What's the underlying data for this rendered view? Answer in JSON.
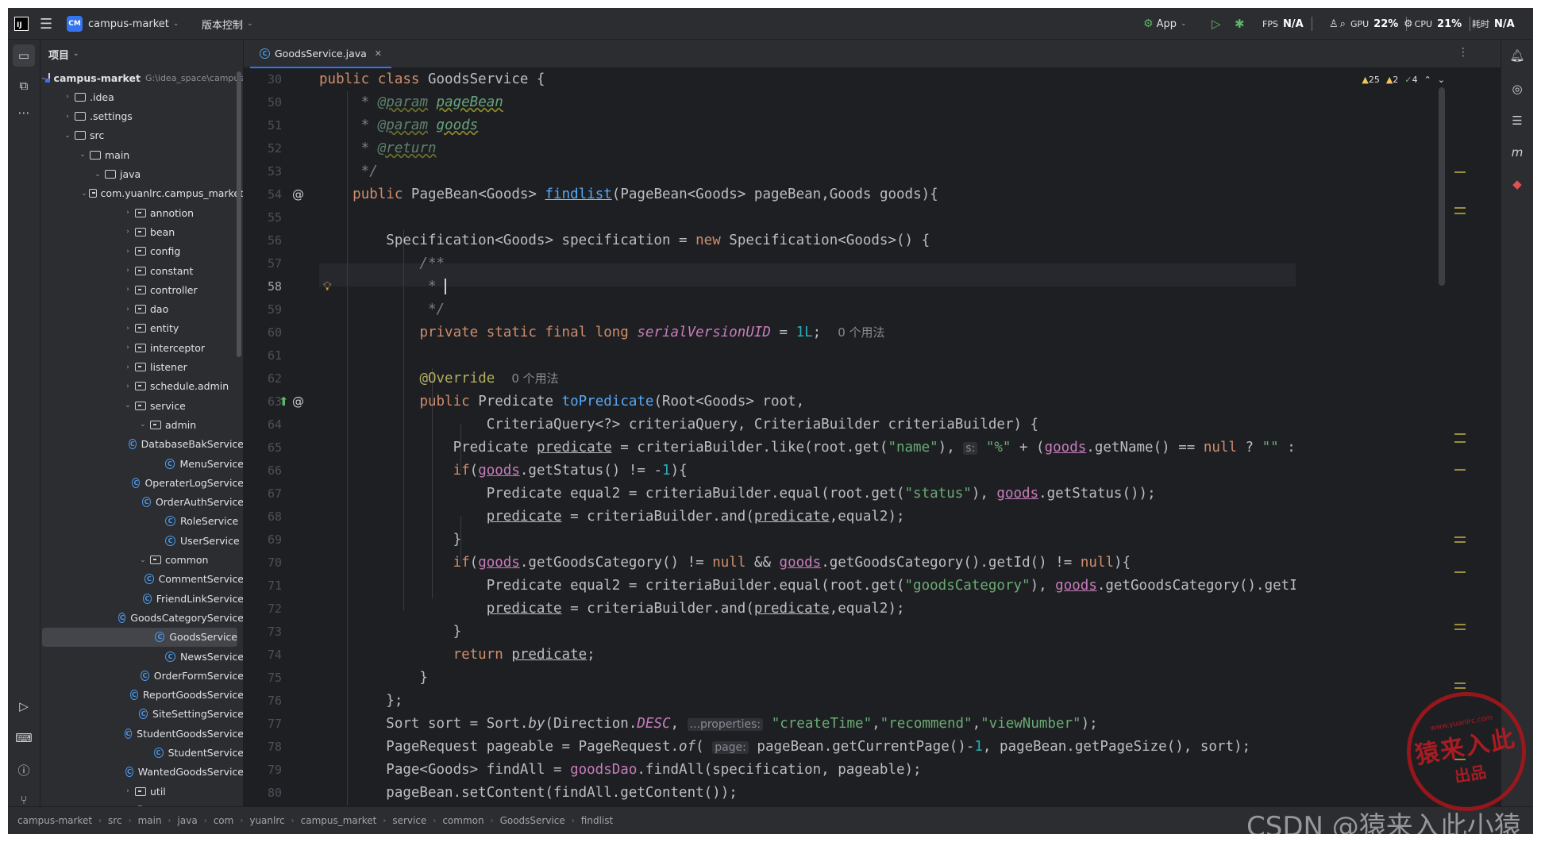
{
  "titlebar": {
    "project_badge": "CM",
    "project_name": "campus-market",
    "vcs_label": "版本控制",
    "run_config": "App",
    "fps_label": "FPS",
    "fps_value": "N/A",
    "gpu_label": "GPU",
    "gpu_value": "22%",
    "cpu_label": "CPU",
    "cpu_value": "21%",
    "time_label": "耗时",
    "time_value": "N/A"
  },
  "project_panel": {
    "header": "项目",
    "rows": [
      {
        "depth": 0,
        "arrow": "⌄",
        "icon": "module",
        "label": "campus-market",
        "path": "G:\\idea_space\\campus-market",
        "bold": true
      },
      {
        "depth": 1,
        "arrow": "›",
        "icon": "folder",
        "label": ".idea"
      },
      {
        "depth": 1,
        "arrow": "›",
        "icon": "folder",
        "label": ".settings"
      },
      {
        "depth": 1,
        "arrow": "⌄",
        "icon": "folder",
        "label": "src"
      },
      {
        "depth": 2,
        "arrow": "⌄",
        "icon": "folder",
        "label": "main"
      },
      {
        "depth": 3,
        "arrow": "⌄",
        "icon": "folder",
        "label": "java"
      },
      {
        "depth": 4,
        "arrow": "⌄",
        "icon": "package",
        "label": "com.yuanlrc.campus_market"
      },
      {
        "depth": 5,
        "arrow": "›",
        "icon": "package",
        "label": "annotion"
      },
      {
        "depth": 5,
        "arrow": "›",
        "icon": "package",
        "label": "bean"
      },
      {
        "depth": 5,
        "arrow": "›",
        "icon": "package",
        "label": "config"
      },
      {
        "depth": 5,
        "arrow": "›",
        "icon": "package",
        "label": "constant"
      },
      {
        "depth": 5,
        "arrow": "›",
        "icon": "package",
        "label": "controller"
      },
      {
        "depth": 5,
        "arrow": "›",
        "icon": "package",
        "label": "dao"
      },
      {
        "depth": 5,
        "arrow": "›",
        "icon": "package",
        "label": "entity"
      },
      {
        "depth": 5,
        "arrow": "›",
        "icon": "package",
        "label": "interceptor"
      },
      {
        "depth": 5,
        "arrow": "›",
        "icon": "package",
        "label": "listener"
      },
      {
        "depth": 5,
        "arrow": "›",
        "icon": "package",
        "label": "schedule.admin"
      },
      {
        "depth": 5,
        "arrow": "⌄",
        "icon": "package",
        "label": "service"
      },
      {
        "depth": 6,
        "arrow": "⌄",
        "icon": "package",
        "label": "admin"
      },
      {
        "depth": 7,
        "arrow": "",
        "icon": "class",
        "label": "DatabaseBakService"
      },
      {
        "depth": 7,
        "arrow": "",
        "icon": "class",
        "label": "MenuService"
      },
      {
        "depth": 7,
        "arrow": "",
        "icon": "class",
        "label": "OperaterLogService"
      },
      {
        "depth": 7,
        "arrow": "",
        "icon": "class",
        "label": "OrderAuthService"
      },
      {
        "depth": 7,
        "arrow": "",
        "icon": "class",
        "label": "RoleService"
      },
      {
        "depth": 7,
        "arrow": "",
        "icon": "class",
        "label": "UserService"
      },
      {
        "depth": 6,
        "arrow": "⌄",
        "icon": "package",
        "label": "common"
      },
      {
        "depth": 7,
        "arrow": "",
        "icon": "class",
        "label": "CommentService"
      },
      {
        "depth": 7,
        "arrow": "",
        "icon": "class",
        "label": "FriendLinkService"
      },
      {
        "depth": 7,
        "arrow": "",
        "icon": "class",
        "label": "GoodsCategoryService"
      },
      {
        "depth": 7,
        "arrow": "",
        "icon": "class",
        "label": "GoodsService",
        "selected": true
      },
      {
        "depth": 7,
        "arrow": "",
        "icon": "class",
        "label": "NewsService"
      },
      {
        "depth": 7,
        "arrow": "",
        "icon": "class",
        "label": "OrderFormService"
      },
      {
        "depth": 7,
        "arrow": "",
        "icon": "class",
        "label": "ReportGoodsService"
      },
      {
        "depth": 7,
        "arrow": "",
        "icon": "class",
        "label": "SiteSettingService"
      },
      {
        "depth": 7,
        "arrow": "",
        "icon": "class",
        "label": "StudentGoodsService"
      },
      {
        "depth": 7,
        "arrow": "",
        "icon": "class",
        "label": "StudentService"
      },
      {
        "depth": 7,
        "arrow": "",
        "icon": "class",
        "label": "WantedGoodsService"
      },
      {
        "depth": 5,
        "arrow": "›",
        "icon": "package",
        "label": "util"
      },
      {
        "depth": 5,
        "arrow": "",
        "icon": "class",
        "label": "App"
      }
    ]
  },
  "editor": {
    "tab_label": "GoodsService.java",
    "inspections": {
      "warnings": "25",
      "weak_warnings": "2",
      "ok": "4"
    },
    "current_line": "58",
    "line_numbers": [
      "30",
      "50",
      "51",
      "52",
      "53",
      "54",
      "55",
      "56",
      "57",
      "58",
      "59",
      "60",
      "61",
      "62",
      "63",
      "64",
      "65",
      "66",
      "67",
      "68",
      "69",
      "70",
      "71",
      "72",
      "73",
      "74",
      "75",
      "76",
      "77",
      "78",
      "79",
      "80"
    ]
  },
  "statusbar": {
    "crumbs": [
      "campus-market",
      "src",
      "main",
      "java",
      "com",
      "yuanlrc",
      "campus_market",
      "service",
      "common",
      "GoodsService",
      "findlist"
    ]
  },
  "watermark": {
    "text": "CSDN @猿来入此小猿",
    "seal_main": "猿来入此",
    "seal_sub": "出品",
    "seal_url": "www.yuanlrc.com"
  }
}
